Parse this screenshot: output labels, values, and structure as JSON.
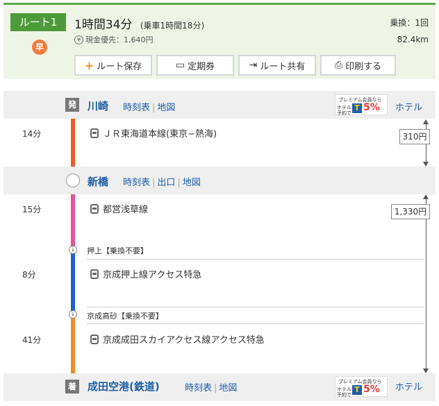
{
  "summary": {
    "route_label": "ルート1",
    "fast_badge": "早",
    "duration": "1時間34分",
    "duration_detail": "(乗車1時間18分)",
    "fare_icon": "¥",
    "fare_label": "現金優先：1,640円",
    "transfers": "乗換：1回",
    "distance": "82.4km"
  },
  "actions": {
    "save": "ルート保存",
    "pass": "定期券",
    "share": "ルート共有",
    "print": "印刷する",
    "icons": {
      "save": "plus-icon",
      "pass": "pass-icon",
      "share": "share-icon",
      "print": "printer-icon"
    }
  },
  "stations": [
    {
      "mark": "発",
      "name": "川崎",
      "links": [
        "時刻表",
        "地図"
      ],
      "hotel": "ホテル",
      "premium": true
    },
    {
      "mark": "",
      "name": "新橋",
      "links": [
        "時刻表",
        "出口",
        "地図"
      ],
      "hotel": "",
      "premium": false
    },
    {
      "mark": "着",
      "name": "成田空港(鉄道)",
      "links": [
        "時刻表",
        "地図"
      ],
      "hotel": "ホテル",
      "premium": true
    }
  ],
  "premium_banner": {
    "line1": "プレミアム会員なら",
    "line2": "ホテル\n予約で",
    "tpoint": "T",
    "percent": "5%"
  },
  "segments": [
    {
      "time": "14分",
      "line": "ＪＲ東海道本線(東京−熱海)",
      "color": "#f15a22"
    },
    {
      "time": "15分",
      "line": "都営浅草線",
      "color": "#e85298"
    },
    {
      "time": "8分",
      "line": "京成押上線アクセス特急",
      "color": "#1e5fd1"
    },
    {
      "time": "41分",
      "line": "京成成田スカイアクセス線アクセス特急",
      "color": "#f08a24"
    }
  ],
  "via": [
    {
      "label": "押上【乗換不要】"
    },
    {
      "label": "京成高砂【乗換不要】"
    }
  ],
  "fares": [
    "310円",
    "1,330円"
  ]
}
